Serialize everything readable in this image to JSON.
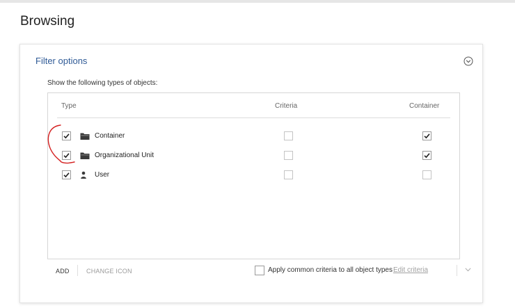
{
  "page": {
    "title": "Browsing"
  },
  "filter": {
    "title": "Filter options",
    "description": "Show the following types of objects:",
    "columns": {
      "type": "Type",
      "criteria": "Criteria",
      "container": "Container"
    },
    "rows": [
      {
        "label": "Container",
        "icon": "folder-icon",
        "checked": true,
        "criteria": false,
        "container": true
      },
      {
        "label": "Organizational Unit",
        "icon": "folder-icon",
        "checked": true,
        "criteria": false,
        "container": true
      },
      {
        "label": "User",
        "icon": "user-icon",
        "checked": true,
        "criteria": false,
        "container": false
      }
    ],
    "footer": {
      "add": "ADD",
      "change_icon": "CHANGE ICON",
      "apply_common": "Apply common criteria to all object types",
      "apply_checked": false,
      "edit_criteria": "Edit criteria"
    }
  },
  "colors": {
    "accent": "#2f5a96",
    "annotation": "#d42020"
  }
}
